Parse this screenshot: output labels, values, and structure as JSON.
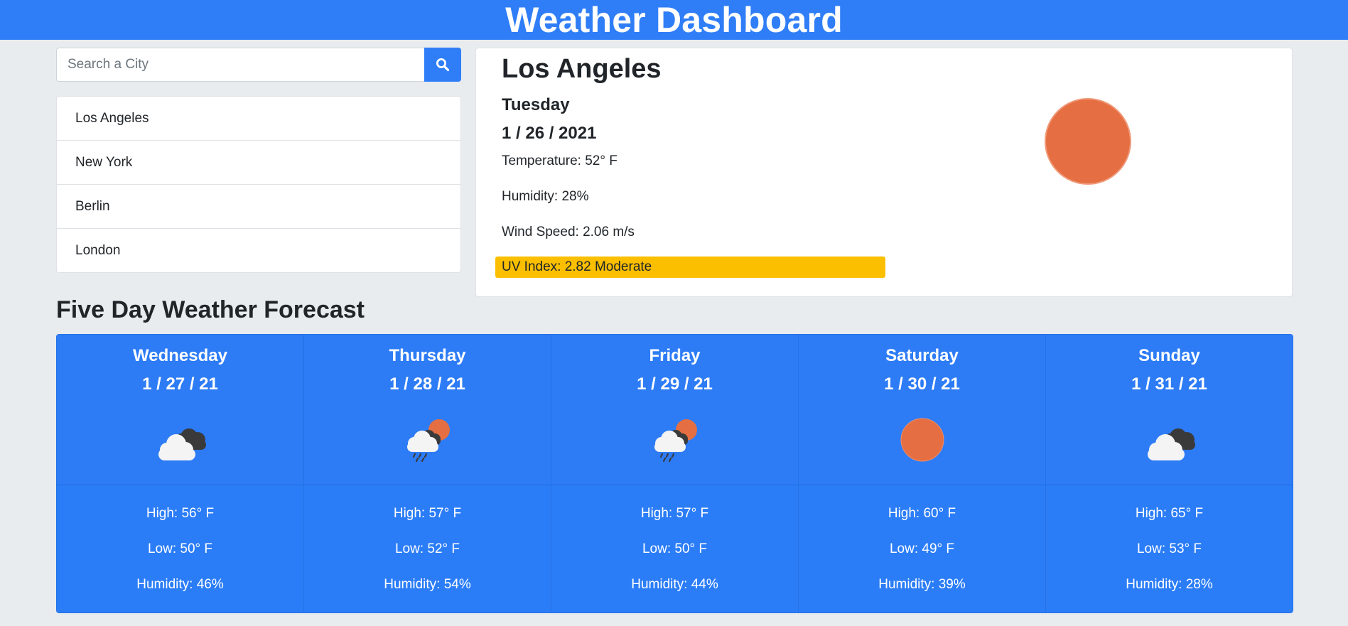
{
  "header": {
    "title": "Weather Dashboard"
  },
  "search": {
    "placeholder": "Search a City",
    "button_icon": "search-icon"
  },
  "cities": [
    "Los Angeles",
    "New York",
    "Berlin",
    "London"
  ],
  "current": {
    "city": "Los Angeles",
    "day": "Tuesday",
    "date": "1 / 26 / 2021",
    "temperature": "Temperature: 52° F",
    "humidity": "Humidity: 28%",
    "wind": "Wind Speed: 2.06 m/s",
    "uv": "UV Index: 2.82 Moderate",
    "icon": "sun-icon",
    "uv_color": "#fbbf00"
  },
  "forecast": {
    "title": "Five Day Weather Forecast",
    "days": [
      {
        "day": "Wednesday",
        "date": "1 / 27 / 21",
        "icon": "cloudy-icon",
        "high": "High: 56° F",
        "low": "Low: 50° F",
        "humidity": "Humidity: 46%"
      },
      {
        "day": "Thursday",
        "date": "1 / 28 / 21",
        "icon": "rain-sun-icon",
        "high": "High: 57° F",
        "low": "Low: 52° F",
        "humidity": "Humidity: 54%"
      },
      {
        "day": "Friday",
        "date": "1 / 29 / 21",
        "icon": "rain-sun-icon",
        "high": "High: 57° F",
        "low": "Low: 50° F",
        "humidity": "Humidity: 44%"
      },
      {
        "day": "Saturday",
        "date": "1 / 30 / 21",
        "icon": "sun-icon",
        "high": "High: 60° F",
        "low": "Low: 49° F",
        "humidity": "Humidity: 39%"
      },
      {
        "day": "Sunday",
        "date": "1 / 31 / 21",
        "icon": "cloudy-icon",
        "high": "High: 65° F",
        "low": "Low: 53° F",
        "humidity": "Humidity: 28%"
      }
    ]
  },
  "colors": {
    "primary": "#2f7ef7",
    "background": "#e9ecef",
    "sun": "#e56f42",
    "uv_moderate": "#fbbf00"
  }
}
